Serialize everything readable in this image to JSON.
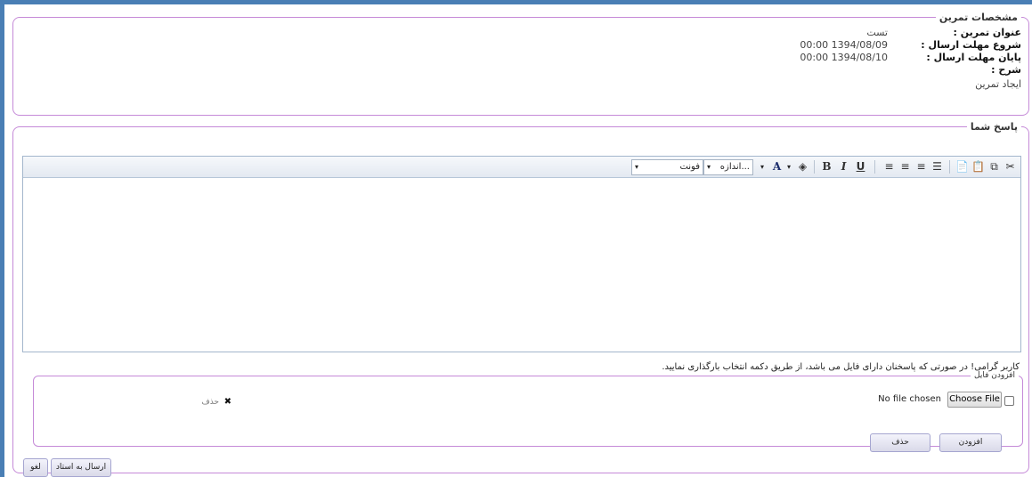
{
  "details": {
    "legend": "مشخصات تمرین",
    "rows": [
      {
        "label": "عنوان تمرین :",
        "value": "تست"
      },
      {
        "label": "شروع مهلت ارسال :",
        "value": "1394/08/09 00:00"
      },
      {
        "label": "پایان مهلت ارسال :",
        "value": "1394/08/10 00:00"
      },
      {
        "label": "شرح :",
        "value": ""
      }
    ],
    "description": "ایجاد تمرین"
  },
  "answer": {
    "legend": "پاسخ شما",
    "editor": {
      "font_select": "فونت",
      "size_select": "اندازه...",
      "content": ""
    },
    "note": "کاربر گرامی! در صورتی که پاسخنان دارای فایل می باشد، از طریق دکمه انتخاب بارگذاری نمایید."
  },
  "upload": {
    "legend": "افزودن فایل",
    "choose_label": "Choose File",
    "no_file": "No file chosen",
    "delete_link": "حذف",
    "add_button": "افزودن",
    "delete_button": "حذف"
  },
  "actions": {
    "send_button": "ارسال به استاد",
    "cancel_button": "لغو"
  },
  "colors": {
    "frame_border": "#c58ad8",
    "window_accent": "#4a7fb5",
    "toolbar_border": "#a3b6cc"
  }
}
